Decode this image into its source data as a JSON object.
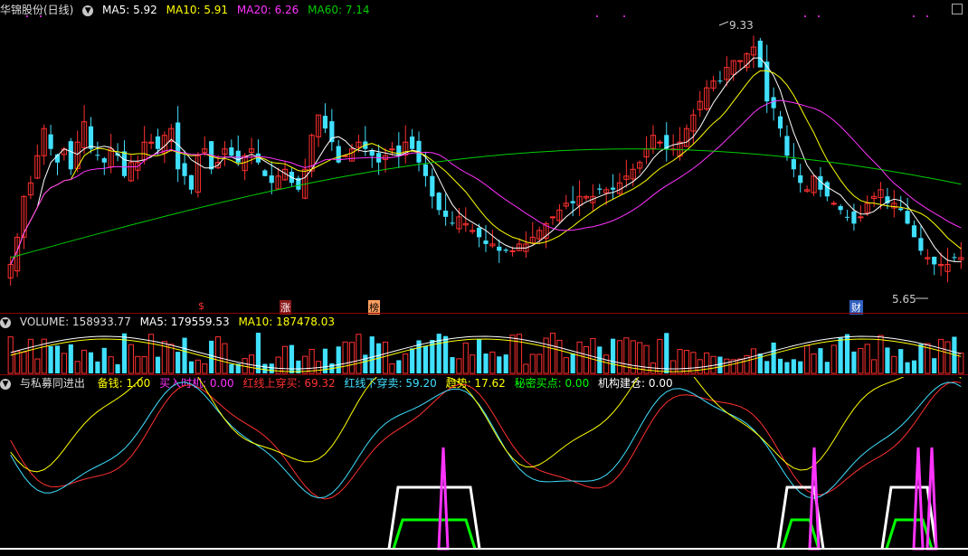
{
  "main_panel": {
    "title": "华锦股份(日线)",
    "ma5_label": "MA5: 5.92",
    "ma10_label": "MA10: 5.91",
    "ma20_label": "MA20: 6.26",
    "ma60_label": "MA60: 7.14",
    "high_label": "9.33",
    "low_label": "5.65",
    "markers": [
      "$",
      "涨",
      "榜",
      "财"
    ]
  },
  "volume_panel": {
    "volume_label": "VOLUME: 158933.77",
    "ma5_label": "MA5: 179559.53",
    "ma10_label": "MA10: 187478.03"
  },
  "indicator_panel": {
    "title": "与私募同进出",
    "items": [
      {
        "label": "备钱: 1.00",
        "color": "#ffff00"
      },
      {
        "label": "买入时机: 0.00",
        "color": "#ff33ff"
      },
      {
        "label": "红线上穿买: 69.32",
        "color": "#ff3030"
      },
      {
        "label": "红线下穿卖: 59.20",
        "color": "#40e0ff"
      },
      {
        "label": "趋势: 17.62",
        "color": "#ffff00"
      },
      {
        "label": "秘密买点: 0.00",
        "color": "#00ff00"
      },
      {
        "label": "机构建仓: 0.00",
        "color": "#ffffff"
      }
    ]
  },
  "colors": {
    "up": "#ff3030",
    "down": "#40e0ff",
    "ma5": "#ffffff",
    "ma10": "#ffff00",
    "ma20": "#ff33ff",
    "ma60": "#00cc00"
  },
  "chart_data": {
    "type": "candlestick",
    "title": "华锦股份(日线)",
    "high": 9.33,
    "low": 5.65,
    "close": [
      5.9,
      6.3,
      6.9,
      7.1,
      7.5,
      7.9,
      7.6,
      7.4,
      7.6,
      7.3,
      7.7,
      8.0,
      7.6,
      7.5,
      7.4,
      7.6,
      7.5,
      7.2,
      7.4,
      7.4,
      7.7,
      7.7,
      7.6,
      7.8,
      7.9,
      7.3,
      7.2,
      7.0,
      7.5,
      7.6,
      7.3,
      7.4,
      7.6,
      7.5,
      7.4,
      7.5,
      7.6,
      7.4,
      7.2,
      7.1,
      7.2,
      7.3,
      7.1,
      7.0,
      7.3,
      7.8,
      8.1,
      7.9,
      7.7,
      7.4,
      7.5,
      7.6,
      7.7,
      7.6,
      7.5,
      7.4,
      7.5,
      7.6,
      7.5,
      7.7,
      7.6,
      7.4,
      7.2,
      6.9,
      6.7,
      6.6,
      6.5,
      6.6,
      6.5,
      6.4,
      6.3,
      6.2,
      6.2,
      6.1,
      6.1,
      6.1,
      6.2,
      6.2,
      6.3,
      6.4,
      6.5,
      6.6,
      6.7,
      6.8,
      6.8,
      6.9,
      6.9,
      6.9,
      7.0,
      7.0,
      7.0,
      7.1,
      7.2,
      7.3,
      7.4,
      7.6,
      7.8,
      7.7,
      7.6,
      7.6,
      7.7,
      7.9,
      8.1,
      8.3,
      8.5,
      8.6,
      8.6,
      8.8,
      8.9,
      8.9,
      9.0,
      9.1,
      8.8,
      8.3,
      8.2,
      7.9,
      7.5,
      7.3,
      7.1,
      7.0,
      7.2,
      7.0,
      6.9,
      6.8,
      6.7,
      6.6,
      6.5,
      6.6,
      6.8,
      6.9,
      7.0,
      6.8,
      6.8,
      6.7,
      6.5,
      6.3,
      6.1,
      6.0,
      5.9,
      5.9,
      5.9,
      6.0,
      6.0
    ],
    "volume_ma5": 179559.53,
    "volume_ma10": 187478.03,
    "volume_last": 158933.77
  }
}
